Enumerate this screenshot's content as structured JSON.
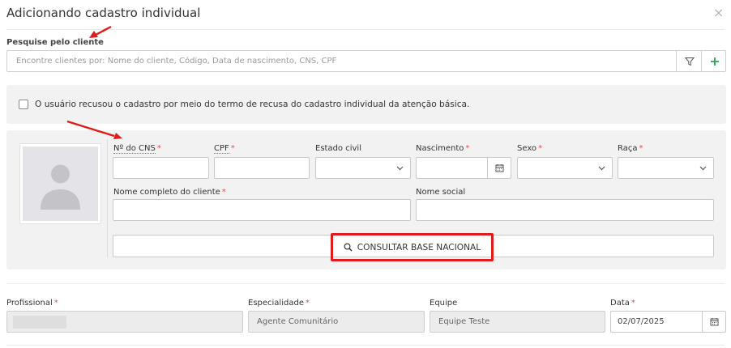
{
  "modal": {
    "title": "Adicionando cadastro individual",
    "close_glyph": "×"
  },
  "search": {
    "label": "Pesquise pelo cliente",
    "placeholder": "Encontre clientes por: Nome do cliente, Código, Data de nascimento, CNS, CPF",
    "filter_icon": "filter-icon",
    "add_icon": "plus-icon"
  },
  "refusal": {
    "label": "O usuário recusou o cadastro por meio do termo de recusa do cadastro individual da atenção básica.",
    "checked": false
  },
  "form": {
    "cns_label": "Nº do CNS",
    "cpf_label": "CPF",
    "civil_label": "Estado civil",
    "birth_label": "Nascimento",
    "sex_label": "Sexo",
    "race_label": "Raça",
    "fullname_label": "Nome completo do cliente",
    "social_label": "Nome social",
    "required_mark": "*",
    "consult_label": "CONSULTAR BASE NACIONAL"
  },
  "footer": {
    "professional_label": "Profissional",
    "specialty_label": "Especialidade",
    "specialty_value": "Agente Comunitário",
    "team_label": "Equipe",
    "team_value": "Equipe Teste",
    "date_label": "Data",
    "date_value": "02/07/2025"
  },
  "colors": {
    "accent_green": "#28a745",
    "required_red": "#d9534f",
    "annotation_red": "#e01b1b"
  }
}
